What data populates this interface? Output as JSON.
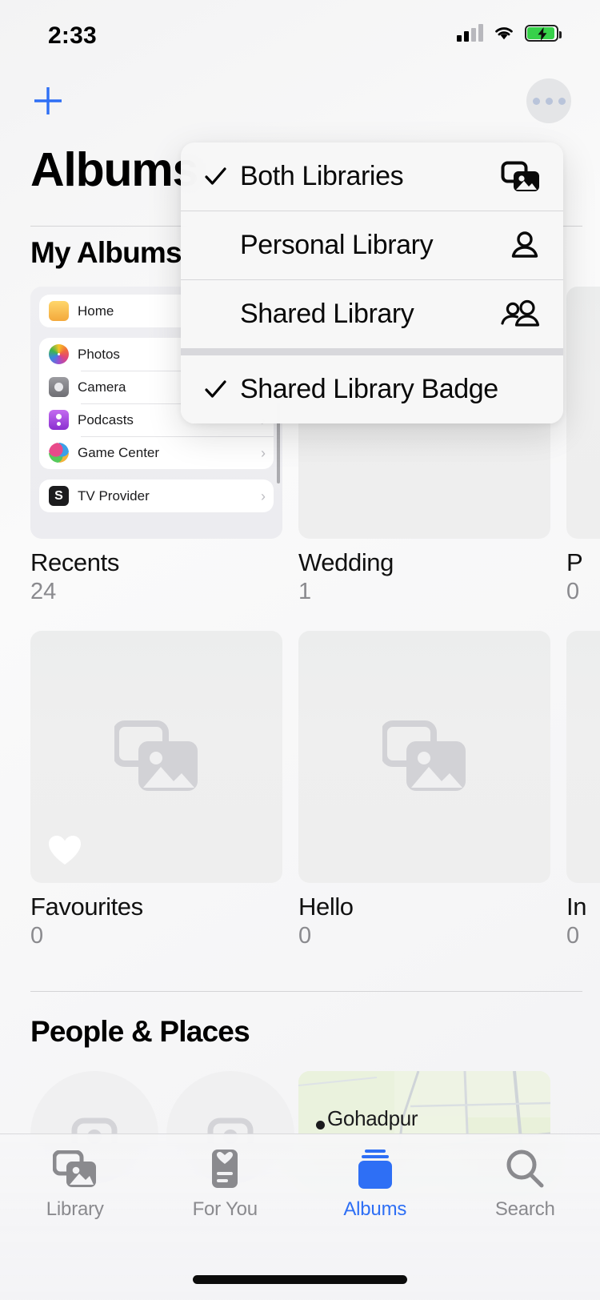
{
  "status_bar": {
    "time": "2:33",
    "signal_icon": "cellular-signal-icon",
    "wifi_icon": "wifi-icon",
    "battery_icon": "battery-charging-icon"
  },
  "nav": {
    "add_icon": "plus-icon",
    "more_icon": "ellipsis-icon"
  },
  "header": {
    "title": "Albums",
    "section_title": "My Albums"
  },
  "menu": {
    "items": [
      {
        "label": "Both Libraries",
        "checked": true,
        "icon": "photo-stack-icon"
      },
      {
        "label": "Personal Library",
        "checked": false,
        "icon": "person-icon"
      },
      {
        "label": "Shared Library",
        "checked": false,
        "icon": "two-people-icon"
      },
      {
        "label": "Shared Library Badge",
        "checked": true,
        "icon": ""
      }
    ]
  },
  "albums": [
    {
      "name": "Recents",
      "count": "24",
      "kind": "settings-screenshot"
    },
    {
      "name": "Wedding",
      "count": "1",
      "kind": "empty"
    },
    {
      "name": "P",
      "count": "0",
      "kind": "empty"
    },
    {
      "name": "Favourites",
      "count": "0",
      "kind": "empty",
      "badge": "heart-icon"
    },
    {
      "name": "Hello",
      "count": "0",
      "kind": "empty"
    },
    {
      "name": "In",
      "count": "0",
      "kind": "empty"
    }
  ],
  "recents_thumbnail": {
    "groups": [
      [
        {
          "label": "Home",
          "icon": "home-app-icon"
        }
      ],
      [
        {
          "label": "Photos",
          "icon": "photos-app-icon"
        },
        {
          "label": "Camera",
          "icon": "camera-app-icon"
        },
        {
          "label": "Podcasts",
          "icon": "podcasts-app-icon"
        },
        {
          "label": "Game Center",
          "icon": "game-center-icon"
        }
      ],
      [
        {
          "label": "TV Provider",
          "icon": "tv-provider-icon"
        }
      ]
    ],
    "chevron": "›"
  },
  "people_places": {
    "title": "People & Places",
    "place_label": "Gohadpur"
  },
  "tabbar": {
    "tabs": [
      {
        "label": "Library",
        "icon": "photo-stack-icon",
        "active": false
      },
      {
        "label": "For You",
        "icon": "for-you-card-icon",
        "active": false
      },
      {
        "label": "Albums",
        "icon": "albums-icon",
        "active": true
      },
      {
        "label": "Search",
        "icon": "search-icon",
        "active": false
      }
    ]
  },
  "colors": {
    "accent": "#2e6ff5",
    "inactive": "#8a8a8e",
    "battery_green": "#37d14a"
  }
}
